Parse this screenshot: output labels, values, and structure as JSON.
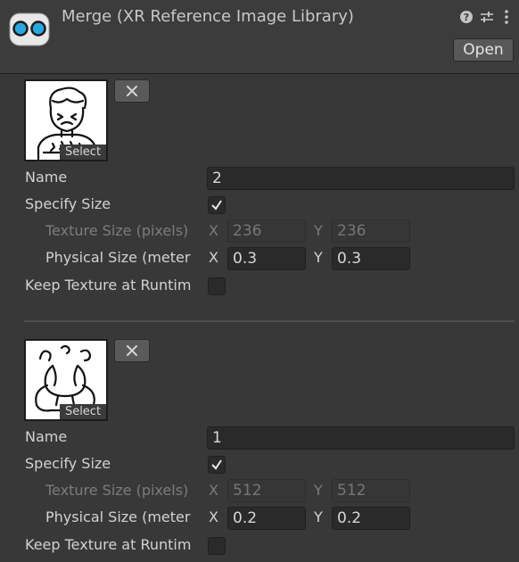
{
  "header": {
    "title": "Merge (XR Reference Image Library)",
    "open_label": "Open",
    "icons": [
      "help-icon",
      "preset-sliders-icon",
      "kebab-menu-icon"
    ]
  },
  "entries": [
    {
      "image": "boy-shivering-cold-icon",
      "select_label": "Select",
      "name_label": "Name",
      "name_value": "2",
      "specify_size_label": "Specify Size",
      "specify_size_checked": true,
      "texture_size_label": "Texture Size (pixels)",
      "texture_x": "236",
      "texture_y": "236",
      "physical_size_label": "Physical Size (meter",
      "physical_x": "0.3",
      "physical_y": "0.3",
      "keep_texture_label": "Keep Texture at Runtim",
      "keep_texture_checked": false
    },
    {
      "image": "stressed-person-icon",
      "select_label": "Select",
      "name_label": "Name",
      "name_value": "1",
      "specify_size_label": "Specify Size",
      "specify_size_checked": true,
      "texture_size_label": "Texture Size (pixels)",
      "texture_x": "512",
      "texture_y": "512",
      "physical_size_label": "Physical Size (meter",
      "physical_x": "0.2",
      "physical_y": "0.2",
      "keep_texture_label": "Keep Texture at Runtim",
      "keep_texture_checked": false
    }
  ],
  "axis": {
    "x": "X",
    "y": "Y"
  }
}
